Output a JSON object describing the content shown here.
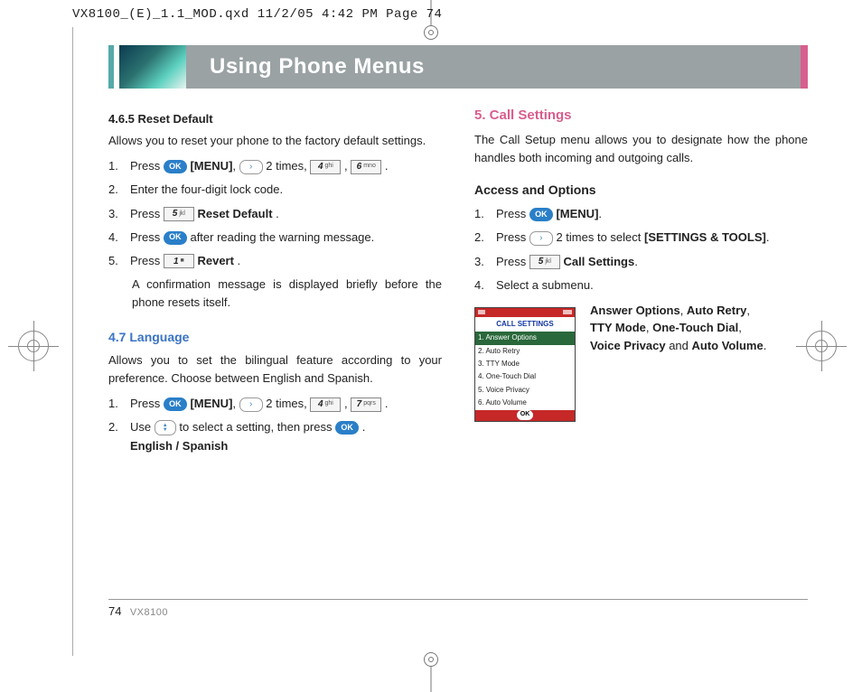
{
  "slug": "VX8100_(E)_1.1_MOD.qxd  11/2/05  4:42 PM  Page 74",
  "title": "Using Phone Menus",
  "left": {
    "h465": "4.6.5 Reset Default",
    "h465_intro": "Allows you to reset your phone to the factory default settings.",
    "steps465": {
      "s1a": "1.",
      "s1b1": "Press ",
      "ok": "OK",
      "menu_bold": "[MENU]",
      "s1b2": ", ",
      "s1b3": " 2 times, ",
      "key4n": "4",
      "key4t": "ghi",
      "comma": " , ",
      "key6n": "6",
      "key6t": "mno",
      "period": " .",
      "s2a": "2.",
      "s2b": "Enter the four-digit lock code.",
      "s3a": "3.",
      "s3b1": "Press ",
      "key5n": "5",
      "key5t": "jkl",
      "s3bold": "Reset Default",
      "s4a": "4.",
      "s4b1": "Press ",
      "s4b2": " after reading the warning message.",
      "s5a": "5.",
      "s5b1": "Press ",
      "key1n": "1",
      "key1t": "■",
      "s5bold": "Revert",
      "note": "A confirmation message is displayed briefly before the phone resets itself."
    },
    "h47": "4.7 Language",
    "h47_intro": "Allows you to set the bilingual feature according to your preference. Choose between English and Spanish.",
    "steps47": {
      "s1a": "1.",
      "s1b1": "Press ",
      "s1b2": ", ",
      "s1b3": " 2 times, ",
      "key7n": "7",
      "key7t": "pqrs",
      "s2a": "2.",
      "s2b1": "Use ",
      "s2b2": " to select a setting, then press ",
      "s2b3": " .",
      "langs": "English / Spanish"
    }
  },
  "right": {
    "h5": "5. Call Settings",
    "h5_intro": "The Call Setup menu allows you to designate how the phone handles both incoming and outgoing calls.",
    "access": "Access and Options",
    "steps": {
      "s1a": "1.",
      "s1b1": "Press ",
      "s1bold": "[MENU]",
      "s1b2": ".",
      "s2a": "2.",
      "s2b1": "Press ",
      "s2b2": " 2 times to select ",
      "s2bold": "[SETTINGS & TOOLS]",
      "s2b3": ".",
      "s3a": "3.",
      "s3b1": "Press ",
      "key5n": "5",
      "key5t": "jkl",
      "s3bold": "Call Settings",
      "s3b2": ".",
      "s4a": "4.",
      "s4b": "Select a submenu."
    },
    "screen": {
      "title": "CALL SETTINGS",
      "items": [
        "1. Answer Options",
        "2. Auto Retry",
        "3. TTY Mode",
        "4. One-Touch Dial",
        "5. Voice Privacy",
        "6. Auto Volume"
      ],
      "ok": "OK"
    },
    "opts": {
      "l1a": "Answer Options",
      "l1b": ", ",
      "l1c": "Auto Retry",
      "l1d": ",",
      "l2a": "TTY Mode",
      "l2b": ", ",
      "l2c": "One-Touch Dial",
      "l2d": ",",
      "l3a": "Voice Privacy",
      "l3b": " and ",
      "l3c": "Auto Volume",
      "l3d": "."
    }
  },
  "footer": {
    "page": "74",
    "model": "VX8100"
  }
}
